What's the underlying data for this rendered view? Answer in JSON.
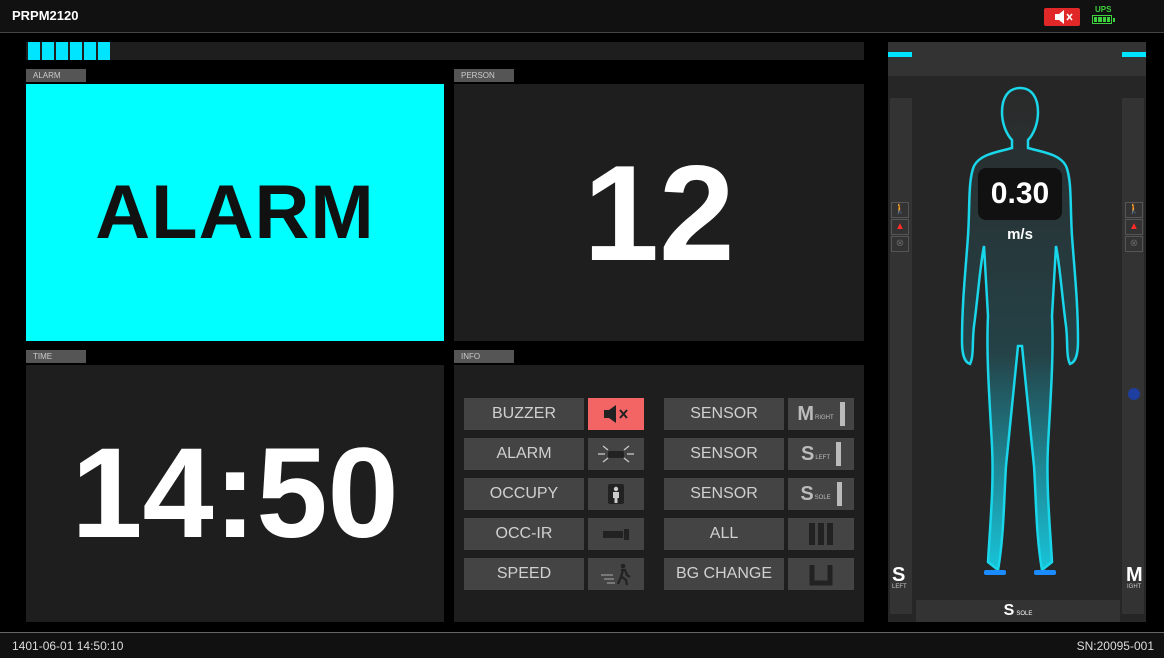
{
  "header": {
    "title": "PRPM2120",
    "ups_label": "UPS",
    "mute_icon": "speaker-muted-icon"
  },
  "progress": {
    "filled_segments": 6
  },
  "alarm_panel": {
    "tab": "ALARM",
    "text": "ALARM",
    "color": "#00ffff"
  },
  "person_panel": {
    "tab": "PERSON",
    "count": "12"
  },
  "time_panel": {
    "tab": "TIME",
    "value": "14:50"
  },
  "info_panel": {
    "tab": "INFO",
    "rows": [
      {
        "label": "BUZZER",
        "icon": "speaker-muted-icon",
        "sensor_label": "SENSOR",
        "sensor_letter": "M",
        "sensor_sub": "RIGHT"
      },
      {
        "label": "ALARM",
        "icon": "beacon-light-icon",
        "sensor_label": "SENSOR",
        "sensor_letter": "S",
        "sensor_sub": "LEFT"
      },
      {
        "label": "OCCUPY",
        "icon": "person-icon",
        "sensor_label": "SENSOR",
        "sensor_letter": "S",
        "sensor_sub": "SOLE"
      },
      {
        "label": "OCC-IR",
        "icon": "ir-sensor-icon",
        "sensor_label": "ALL",
        "sensor_icon": "all-sensors-icon"
      },
      {
        "label": "SPEED",
        "icon": "walking-speed-icon",
        "sensor_label": "BG CHANGE",
        "sensor_icon": "bg-change-icon"
      }
    ]
  },
  "portal": {
    "speed_value": "0.30",
    "speed_unit": "m/s",
    "left_letter": "S",
    "left_sub": "LEFT",
    "right_letter": "M",
    "right_sub": "IGHT",
    "sole_letter": "S",
    "sole_sub": "SOLE",
    "accent": "#00e5ff"
  },
  "status": {
    "datetime": "1401-06-01 14:50:10",
    "serial": "SN:20095-001"
  }
}
